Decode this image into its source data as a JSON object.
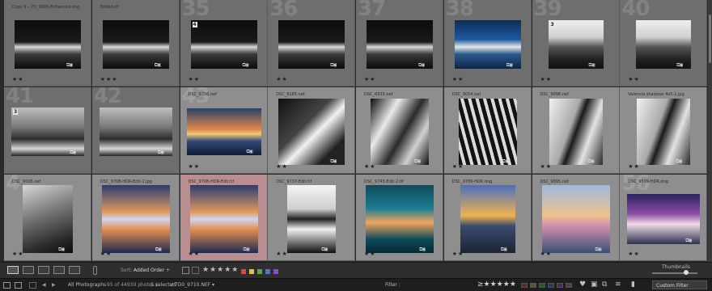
{
  "grid": {
    "rows": [
      {
        "cells": [
          {
            "num": "",
            "filename": "Copy 9 – 7D_0095-Enhanced.dng",
            "stars": "★★",
            "tone": "dark",
            "version": "",
            "thumb": "bw-arch"
          },
          {
            "num": "",
            "filename": "Edited.tif",
            "stars": "★★★",
            "tone": "dark",
            "version": "",
            "thumb": "bw-arch"
          },
          {
            "num": "35",
            "filename": "",
            "stars": "★★",
            "tone": "dark",
            "version": "4",
            "thumb": "bw-arch"
          },
          {
            "num": "36",
            "filename": "",
            "stars": "★★",
            "tone": "dark",
            "version": "",
            "thumb": "bw-arch"
          },
          {
            "num": "37",
            "filename": "",
            "stars": "★★",
            "tone": "dark",
            "version": "",
            "thumb": "bw-arch"
          },
          {
            "num": "38",
            "filename": "",
            "stars": "★★",
            "tone": "dark",
            "version": "",
            "thumb": "blue-arch"
          },
          {
            "num": "39",
            "filename": "",
            "stars": "★★",
            "tone": "dark",
            "version": "3",
            "thumb": "bw-building"
          },
          {
            "num": "40",
            "filename": "",
            "stars": "★★",
            "tone": "dark",
            "version": "",
            "thumb": "bw-building"
          }
        ]
      },
      {
        "cells": [
          {
            "num": "41",
            "filename": "",
            "stars": "",
            "tone": "dark",
            "version": "3",
            "thumb": "bw-city"
          },
          {
            "num": "42",
            "filename": "",
            "stars": "",
            "tone": "dark",
            "version": "",
            "thumb": "bw-city"
          },
          {
            "num": "43",
            "filename": "DSC_9256.nef",
            "stars": "★★",
            "tone": "light",
            "version": "",
            "thumb": "sunset-pier"
          },
          {
            "num": "",
            "filename": "DSC_9165.nef",
            "stars": "★★",
            "tone": "light",
            "version": "",
            "thumb": "bw-triangle"
          },
          {
            "num": "",
            "filename": "DSC_8933.nef",
            "stars": "★★",
            "tone": "light",
            "version": "",
            "thumb": "bw-curve"
          },
          {
            "num": "",
            "filename": "DSC_9054.nef",
            "stars": "★★",
            "tone": "light",
            "version": "",
            "thumb": "bw-ribs"
          },
          {
            "num": "",
            "filename": "DSC_9096.nef",
            "stars": "★★",
            "tone": "light",
            "version": "",
            "thumb": "bw-person"
          },
          {
            "num": "",
            "filename": "Valencia shadows 4x5-1.jpg",
            "stars": "★★",
            "tone": "light",
            "version": "",
            "thumb": "bw-person"
          }
        ]
      },
      {
        "cells": [
          {
            "num": "4",
            "filename": "DSC_9006.nef",
            "stars": "★★",
            "tone": "light",
            "version": "",
            "thumb": "bw-portrait"
          },
          {
            "num": "",
            "filename": "DSC_9708-HDR-Edit-2.jpg",
            "stars": "★★",
            "tone": "light",
            "version": "",
            "thumb": "color-reflect"
          },
          {
            "num": "",
            "filename": "DSC_9708-HDR-Edit.tif",
            "stars": "★★",
            "tone": "pink",
            "version": "",
            "thumb": "color-reflect"
          },
          {
            "num": "",
            "filename": "DSC_9737-Edit.tif",
            "stars": "★★",
            "tone": "light",
            "version": "",
            "thumb": "bw-reflect"
          },
          {
            "num": "",
            "filename": "DSC_9743-Edit-2.tif",
            "stars": "★★",
            "tone": "light",
            "version": "",
            "thumb": "teal-arch"
          },
          {
            "num": "",
            "filename": "DSC_9789-HDR.dng",
            "stars": "★★",
            "tone": "light",
            "version": "",
            "thumb": "reeds-sunset"
          },
          {
            "num": "",
            "filename": "DSC_9895.nef",
            "stars": "★★",
            "tone": "light",
            "version": "",
            "thumb": "calm-sea"
          },
          {
            "num": "56",
            "filename": "DSC_9699-HDR.dng",
            "stars": "★★",
            "tone": "light",
            "version": "",
            "thumb": "purple-building"
          }
        ]
      }
    ]
  },
  "toolbar": {
    "sort_label": "Sort:",
    "sort_value": "Added Order ÷",
    "stars": "★★★★★",
    "color_labels": [
      "#d24a4a",
      "#d8c24a",
      "#5aa64c",
      "#4c78c8",
      "#8a4cc8"
    ],
    "thumbnails_label": "Thumbnails"
  },
  "filmstrip": {
    "source": "All Photographs",
    "count": "95 of 44939 photos /",
    "selected": "1 selected",
    "file": "/ 7D0_9710.NEF ▾",
    "filter_label": "Filter :",
    "custom_filter": "Custom Filter"
  }
}
